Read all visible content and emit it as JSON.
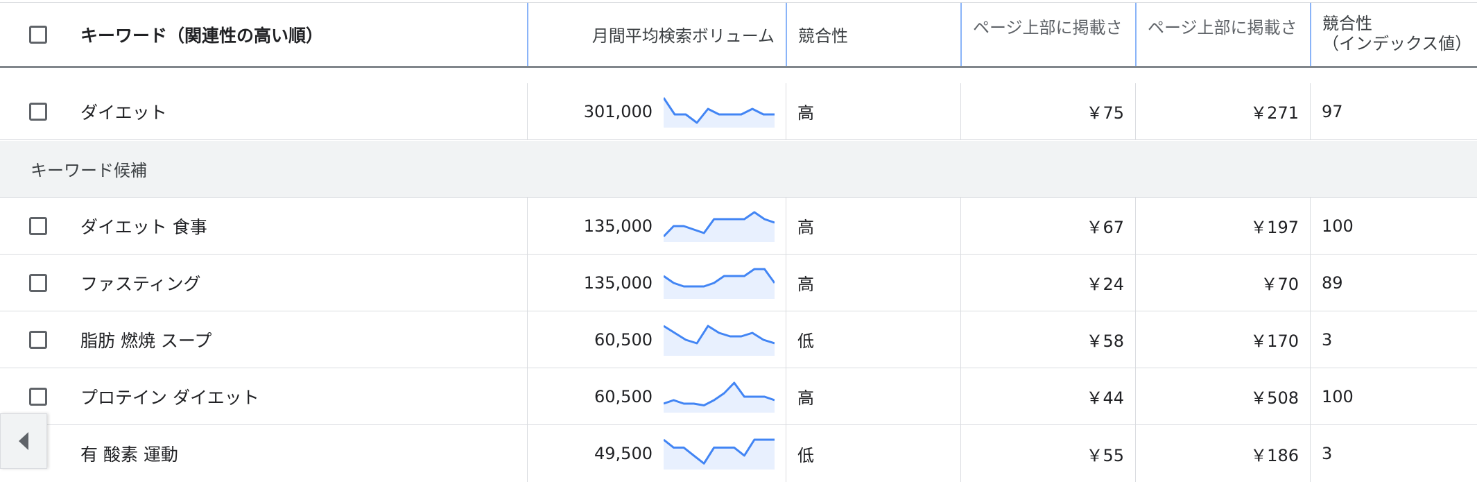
{
  "header": {
    "keyword": "キーワード（関連性の高い順）",
    "monthly_volume": "月間平均検索ボリューム",
    "competition": "競合性",
    "bid_low": "ページ上部に掲載さ",
    "bid_high": "ページ上部に掲載さ",
    "comp_index_line1": "競合性",
    "comp_index_line2": "（インデックス値）"
  },
  "provided": [
    {
      "keyword": "ダイエット",
      "volume": "301,000",
      "competition": "高",
      "bid_low": "￥75",
      "bid_high": "￥271",
      "index": "97",
      "trend": [
        10,
        4,
        4,
        1,
        6,
        4,
        4,
        4,
        6,
        4,
        4
      ]
    }
  ],
  "group_label": "キーワード候補",
  "ideas": [
    {
      "keyword": "ダイエット 食事",
      "volume": "135,000",
      "competition": "高",
      "bid_low": "￥67",
      "bid_high": "￥197",
      "index": "100",
      "trend": [
        1,
        4,
        4,
        3,
        2,
        6,
        6,
        6,
        6,
        8,
        6,
        5
      ]
    },
    {
      "keyword": "ファスティング",
      "volume": "135,000",
      "competition": "高",
      "bid_low": "￥24",
      "bid_high": "￥70",
      "index": "89",
      "trend": [
        6,
        4,
        3,
        3,
        3,
        4,
        6,
        6,
        6,
        8,
        8,
        4
      ]
    },
    {
      "keyword": "脂肪 燃焼 スープ",
      "volume": "60,500",
      "competition": "低",
      "bid_low": "￥58",
      "bid_high": "￥170",
      "index": "3",
      "trend": [
        8,
        6,
        4,
        3,
        8,
        6,
        5,
        5,
        6,
        4,
        3
      ]
    },
    {
      "keyword": "プロテイン ダイエット",
      "volume": "60,500",
      "competition": "高",
      "bid_low": "￥44",
      "bid_high": "￥508",
      "index": "100",
      "trend": [
        2,
        3,
        2,
        2,
        1.5,
        3,
        5,
        8,
        4,
        4,
        4,
        3
      ]
    },
    {
      "keyword": "有 酸素 運動",
      "volume": "49,500",
      "competition": "低",
      "bid_low": "￥55",
      "bid_high": "￥186",
      "index": "3",
      "trend": [
        7,
        5,
        5,
        3,
        1,
        5,
        5,
        5,
        3,
        7,
        7,
        7
      ]
    }
  ],
  "colors": {
    "accent": "#4285f4",
    "spark_fill": "#e8f0fe",
    "header_divider": "#8ab4f8"
  },
  "icons": {
    "scroll": "chevron-left-icon"
  }
}
